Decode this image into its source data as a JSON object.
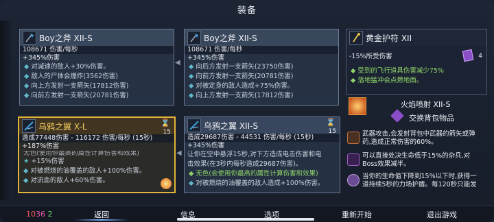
{
  "title": "装备",
  "card1": {
    "name": "Boy之斧 XII-S",
    "dps": "108671 伤害/每秒",
    "bonus": "+345%伤害",
    "bullets": [
      "对减速的敌人+30%伤害。",
      "敌人的尸体会爆炸(3562伤害)",
      "向上方发射一支箭矢(17812伤害)",
      "向前方发射一支箭矢(20781伤害)"
    ]
  },
  "card2": {
    "name": "Boy之斧 XII-S",
    "dps": "108671 伤害/每秒",
    "bonus": "+345%伤害",
    "bullets": [
      "向后方发射一支箭矢(23750伤害)",
      "向前方发射一支箭矢(20781伤害)",
      "对被定身的敌人造成+75%伤害。",
      "向上方发射一支箭矢(17812伤害)"
    ]
  },
  "card3": {
    "name": "黄金护符 XII",
    "count": "4",
    "stat": "-15%所受伤害",
    "bullets": [
      "受到的飞行道具伤害减少75%",
      "落地猛冲会点燃地面。"
    ],
    "bullet2_hl": "燃"
  },
  "card4": {
    "name": "乌鸦之翼 X-L",
    "hourglass_count": "15",
    "dps": "造成77448伤害 - 116172 伤害/每秒 (15秒)",
    "bonus": "+187%伤害",
    "line_cut": "无色(使用你最高的属性计算伤害和效果)",
    "buff": "+15%伤害",
    "bullets": [
      "对被燃烧的油覆盖的敌人+100%伤害。",
      "对流血的敌人+60%伤害。"
    ]
  },
  "card5": {
    "name": "乌鸦之翼 XII-S",
    "hourglass_count": "15",
    "dps": "造成29687伤害 - 44531 伤害/每秒 (15秒)",
    "bonus": "+345%伤害",
    "line1": "让你在空中悬浮15秒,对下方造成电击伤害和电",
    "line2": "击效果(在3秒内每秒造成29687伤害)。",
    "line3": "无色(会使用你最高的属性计算伤害和效果)",
    "line4": "对被燃烧的油覆盖的敌人造成+100%伤害。"
  },
  "skill": {
    "name": "火焰喷射 XII-S",
    "swap": "交换背包物品",
    "desc": [
      "武器攻击,会发射背包中武器的箭矢或弹药,造成正常伤害的60%。",
      "可以直接处决生命低于15%的杂兵,对Boss效果减半。",
      "当你的生命值下降到15%以下时,获得一道持续5秒的力场护盾。每120秒只能发"
    ]
  },
  "counter": {
    "a": "10",
    "b": "36",
    "c": "2"
  },
  "menu": [
    "返回",
    "信息",
    "选项",
    "重新开始",
    "退出游戏"
  ]
}
